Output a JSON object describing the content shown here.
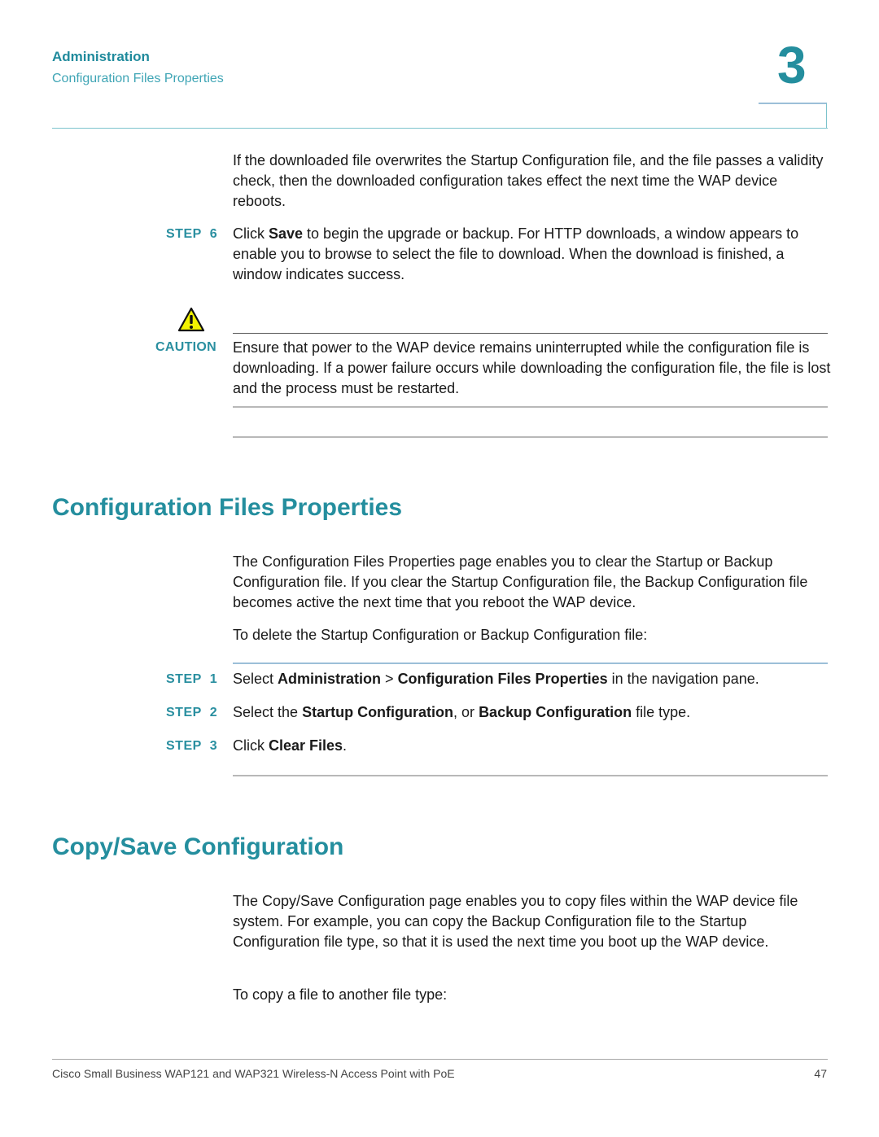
{
  "header": {
    "section": "Administration",
    "subsection": "Configuration Files Properties",
    "chapter_number": "3"
  },
  "intro": {
    "paragraph": "If the downloaded file overwrites the Startup Configuration file, and the file passes a validity check, then the downloaded configuration takes effect the next time the WAP device reboots."
  },
  "step6": {
    "label": "STEP",
    "number": "6",
    "pre": "Click ",
    "bold": "Save",
    "post": " to begin the upgrade or backup. For HTTP downloads, a window appears to enable you to browse to select the file to download. When the download is finished, a window indicates success."
  },
  "caution": {
    "icon": "warning-triangle-icon",
    "label": "CAUTION",
    "text": "Ensure that power to the WAP device remains uninterrupted while the configuration file is downloading. If a power failure occurs while downloading the configuration file, the file is lost and the process must be restarted."
  },
  "section_config_files": {
    "title": "Configuration Files Properties",
    "paragraph": "The Configuration Files Properties page enables you to clear the Startup or Backup Configuration file. If you clear the Startup Configuration file, the Backup Configuration file becomes active the next time that you reboot the WAP device.",
    "lead": "To delete the Startup Configuration or Backup Configuration file:",
    "steps": [
      {
        "label": "STEP",
        "number": "1",
        "t1": "Select ",
        "b1": "Administration",
        "t2": " > ",
        "b2": "Configuration Files Properties",
        "t3": " in the navigation pane."
      },
      {
        "label": "STEP",
        "number": "2",
        "t1": "Select the ",
        "b1": "Startup Configuration",
        "t2": ", or ",
        "b2": "Backup Configuration",
        "t3": " file type."
      },
      {
        "label": "STEP",
        "number": "3",
        "t1": "Click ",
        "b1": "Clear Files",
        "t2": "."
      }
    ]
  },
  "section_copy_save": {
    "title": "Copy/Save Configuration",
    "paragraph": "The Copy/Save Configuration page enables you to copy files within the WAP device file system. For example, you can copy the Backup Configuration file to the Startup Configuration file type, so that it is used the next time you boot up the WAP device.",
    "lead": "To copy a file to another file type:"
  },
  "footer": {
    "title": "Cisco Small Business WAP121 and WAP321 Wireless-N Access Point with PoE",
    "page_number": "47"
  },
  "colors": {
    "accent": "#248e9e",
    "caution_yellow": "#f2f200"
  }
}
